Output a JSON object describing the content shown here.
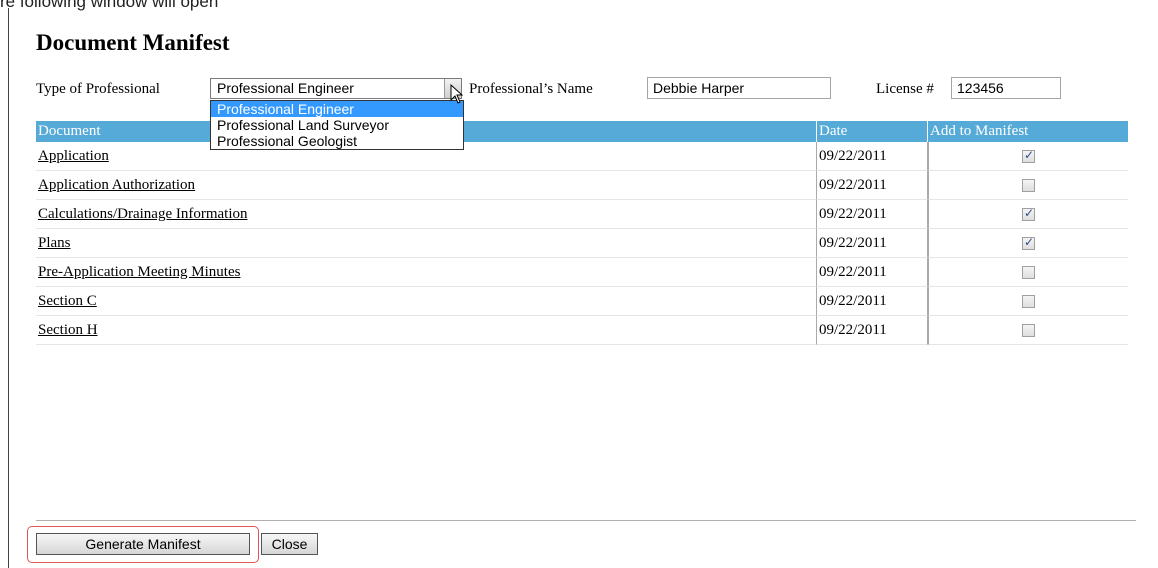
{
  "caption": "re following window will open",
  "page_title": "Document Manifest",
  "form": {
    "type_label": "Type of Professional",
    "type_selected": "Professional Engineer",
    "type_options": [
      "Professional Engineer",
      "Professional Land Surveyor",
      "Professional Geologist"
    ],
    "name_label": "Professional’s Name",
    "name_value": "Debbie Harper",
    "license_label": "License #",
    "license_value": "123456"
  },
  "table": {
    "headers": [
      "Document",
      "Date",
      "Add to Manifest"
    ],
    "rows": [
      {
        "document": "Application",
        "date": "09/22/2011",
        "checked": true
      },
      {
        "document": "Application Authorization",
        "date": "09/22/2011",
        "checked": false
      },
      {
        "document": "Calculations/Drainage Information",
        "date": "09/22/2011",
        "checked": true
      },
      {
        "document": "Plans",
        "date": "09/22/2011",
        "checked": true
      },
      {
        "document": "Pre-Application Meeting Minutes",
        "date": "09/22/2011",
        "checked": false
      },
      {
        "document": "Section C",
        "date": "09/22/2011",
        "checked": false
      },
      {
        "document": "Section H",
        "date": "09/22/2011",
        "checked": false
      }
    ]
  },
  "buttons": {
    "generate": "Generate Manifest",
    "close": "Close"
  },
  "colors": {
    "header_bg": "#55aad8",
    "selected_option_bg": "#3399ff",
    "highlight_border": "#e05555"
  }
}
